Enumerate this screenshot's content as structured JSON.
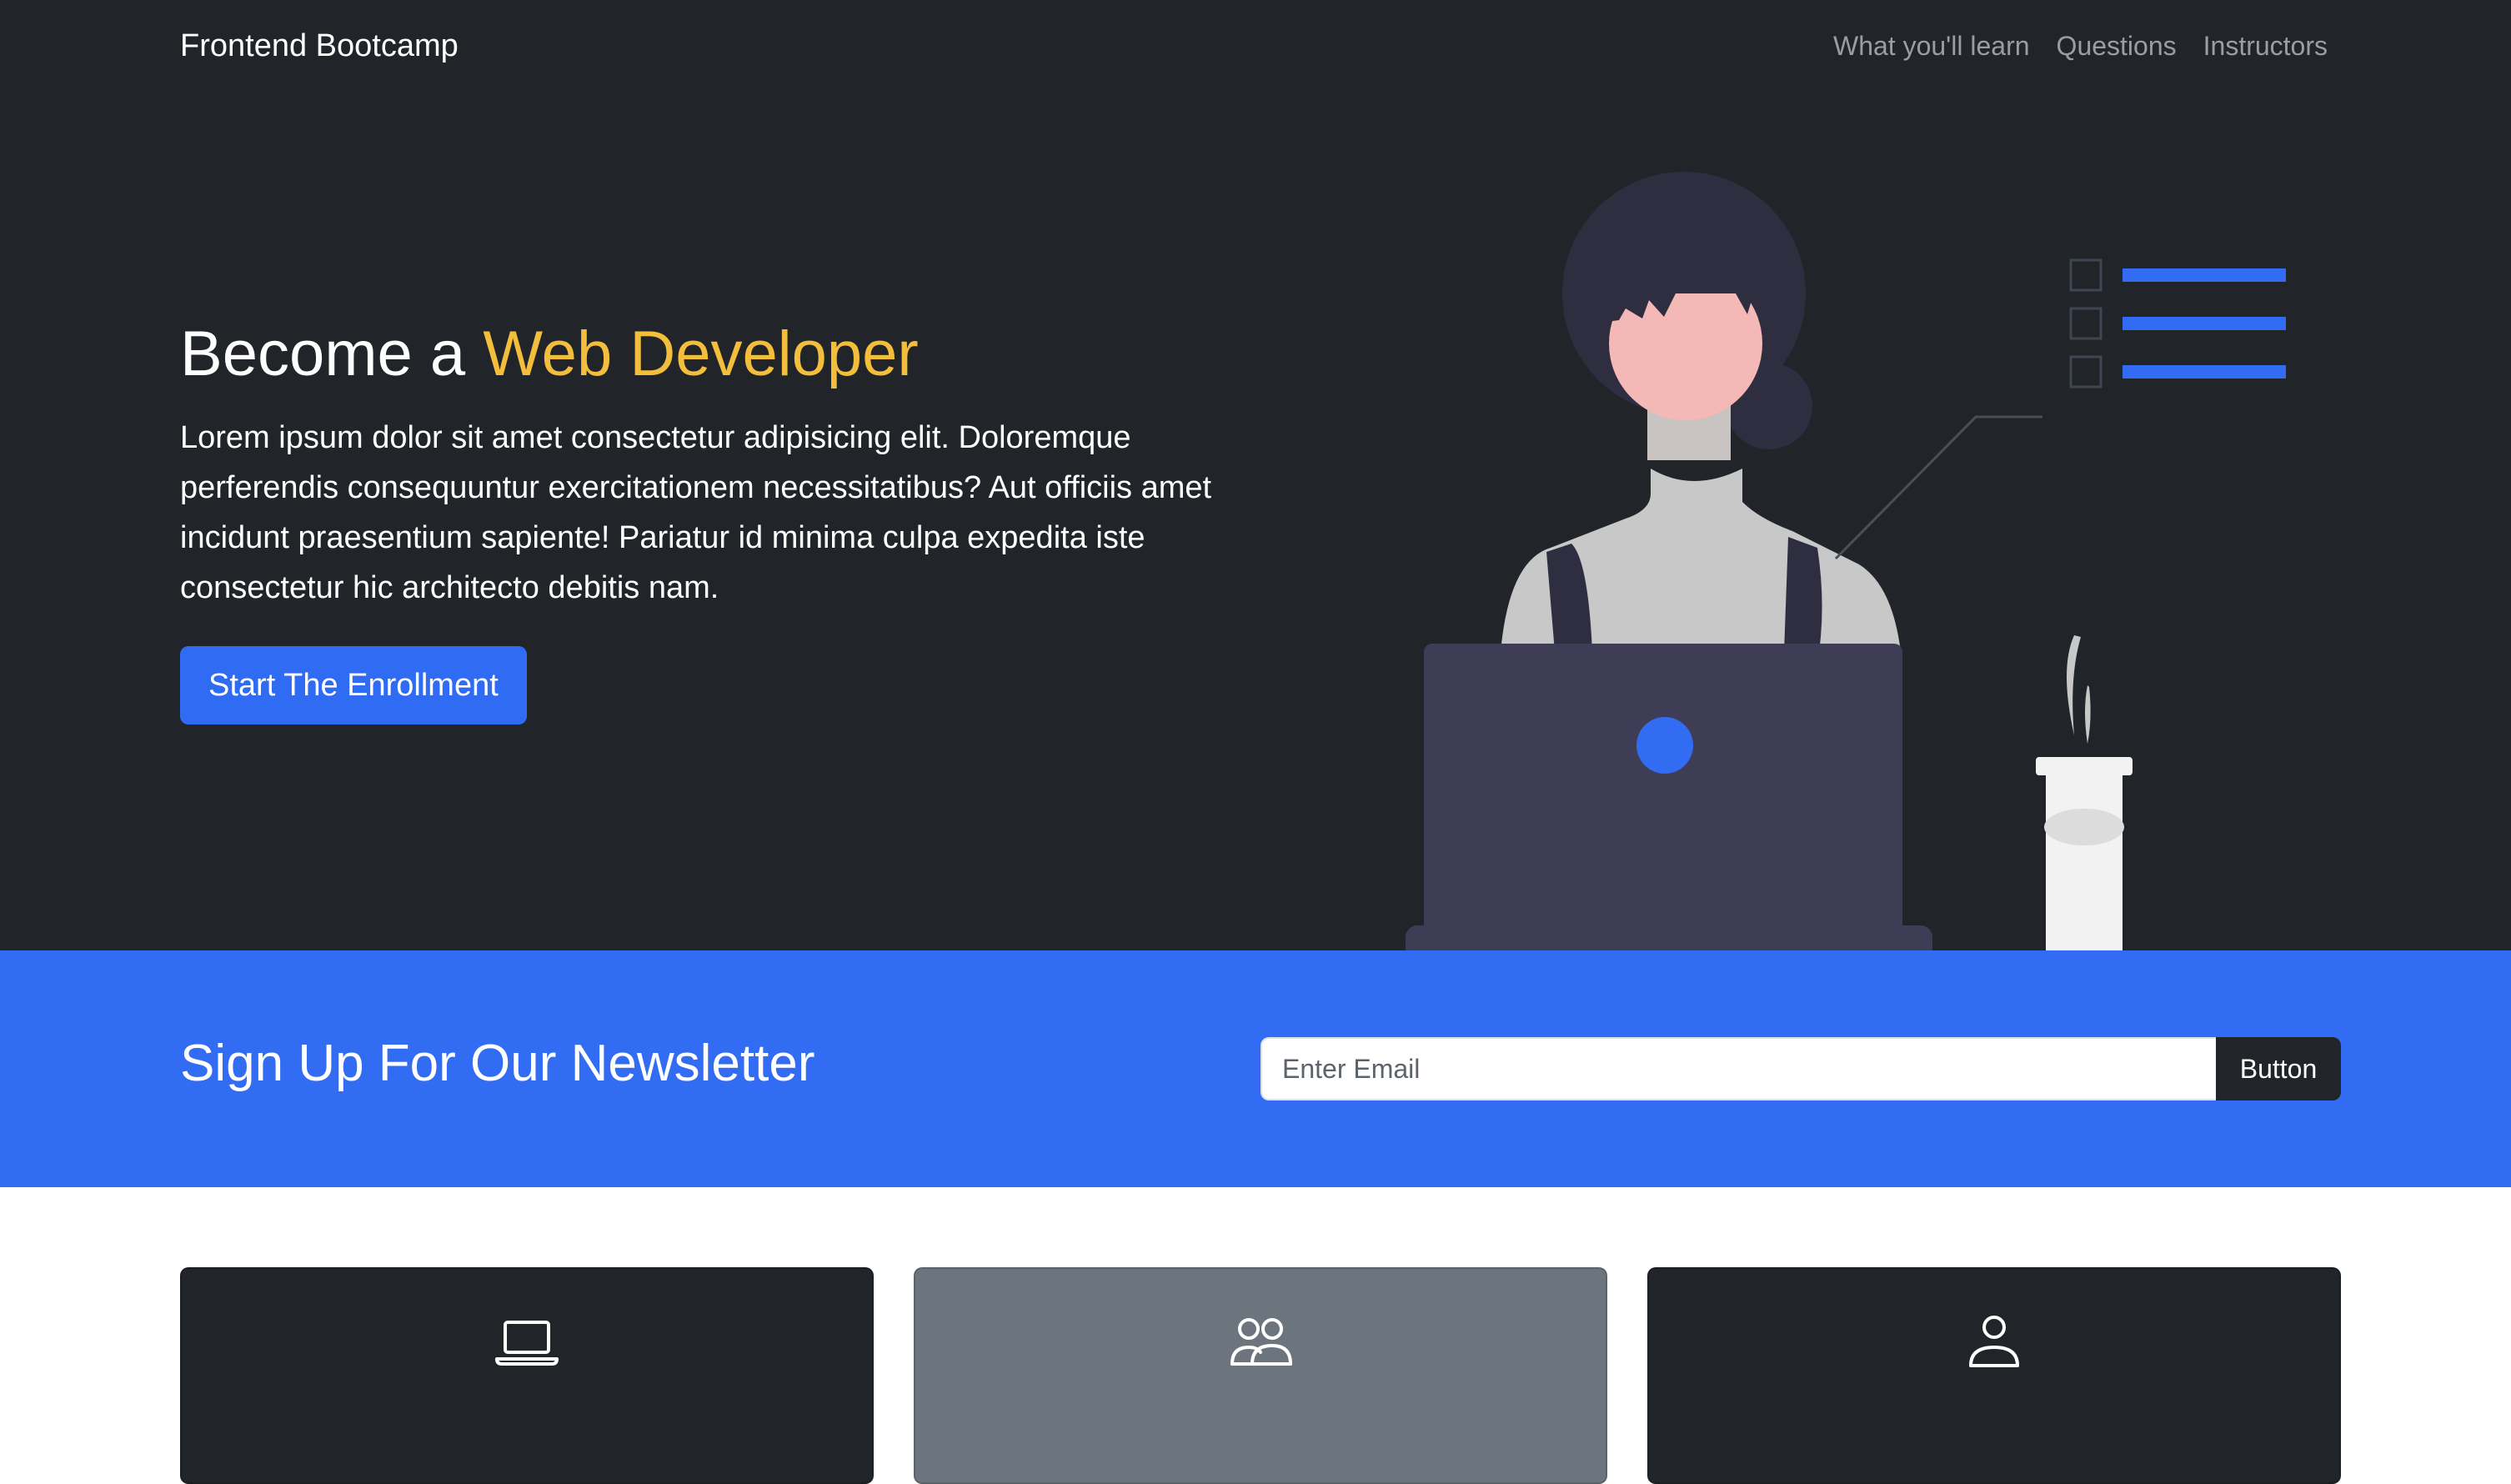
{
  "navbar": {
    "brand": "Frontend Bootcamp",
    "links": [
      "What you'll learn",
      "Questions",
      "Instructors"
    ]
  },
  "hero": {
    "title_prefix": "Become a ",
    "title_highlight": "Web Developer",
    "description": "Lorem ipsum dolor sit amet consectetur adipisicing elit. Doloremque perferendis consequuntur exercitationem necessitatibus? Aut officiis amet incidunt praesentium sapiente! Pariatur id minima culpa expedita iste consectetur hic architecto debitis nam.",
    "cta_label": "Start The Enrollment",
    "illustration": "woman-at-laptop-illustration"
  },
  "newsletter": {
    "title": "Sign Up For Our Newsletter",
    "email_placeholder": "Enter Email",
    "email_value": "",
    "button_label": "Button"
  },
  "cards": [
    {
      "icon": "laptop-icon",
      "background": "dark"
    },
    {
      "icon": "people-icon",
      "background": "gray"
    },
    {
      "icon": "person-icon",
      "background": "dark"
    }
  ],
  "colors": {
    "dark": "#212529",
    "primary": "#316cf2",
    "highlight": "#f2be3c",
    "gray": "#6c757d"
  }
}
